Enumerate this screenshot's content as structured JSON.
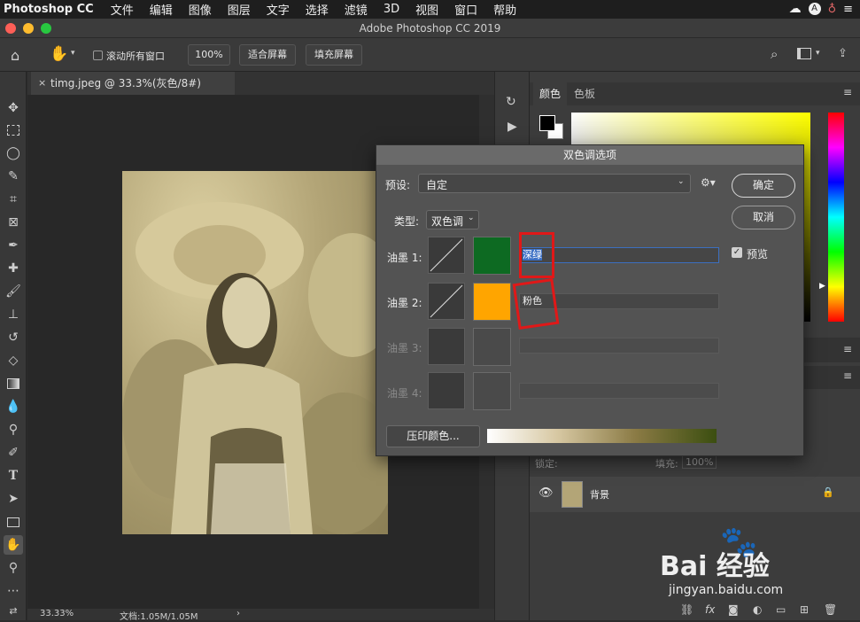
{
  "menubar": {
    "app": "Photoshop CC",
    "items": [
      "文件",
      "编辑",
      "图像",
      "图层",
      "文字",
      "选择",
      "滤镜",
      "3D",
      "视图",
      "窗口",
      "帮助"
    ]
  },
  "window": {
    "title": "Adobe Photoshop CC 2019"
  },
  "options_bar": {
    "scroll_all_label": "滚动所有窗口",
    "zoom_value": "100%",
    "fit_screen": "适合屏幕",
    "fill_screen": "填充屏幕"
  },
  "document": {
    "tab_title": "timg.jpeg @ 33.3%(灰色/8#)",
    "zoom_status": "33.33%",
    "doc_size": "文档:1.05M/1.05M"
  },
  "color_panel": {
    "tab_color": "颜色",
    "tab_swatches": "色板"
  },
  "layers_panel": {
    "lock_label": "锁定:",
    "fill_label": "填充:",
    "fill_value": "100%",
    "layer_name": "背景"
  },
  "dialog": {
    "title": "双色调选项",
    "preset_label": "预设:",
    "preset_value": "自定",
    "type_label": "类型:",
    "type_value": "双色调",
    "ok": "确定",
    "cancel": "取消",
    "preview_label": "预览",
    "ink1_label": "油墨 1:",
    "ink1_name": "深绿",
    "ink2_label": "油墨 2:",
    "ink2_name": "粉色",
    "ink3_label": "油墨 3:",
    "ink4_label": "油墨 4:",
    "overprint_button": "压印颜色..."
  },
  "colors": {
    "ink1": "#0d6a22",
    "ink2": "#ffa500",
    "gradient_start": "#ffffff",
    "gradient_end": "#3b4e10",
    "highlight": "#e01818"
  },
  "watermark": {
    "brand": "Bai 经验",
    "url": "jingyan.baidu.com"
  }
}
